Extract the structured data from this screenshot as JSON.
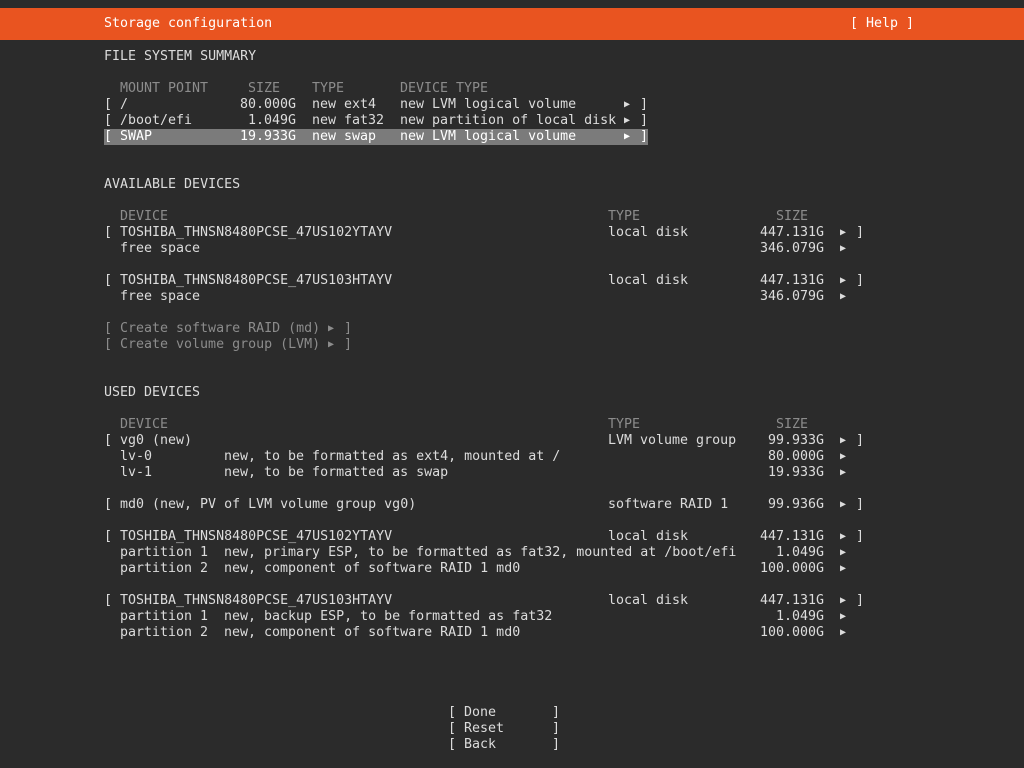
{
  "header": {
    "title": "Storage configuration",
    "help": "[ Help ]"
  },
  "fs_summary": {
    "heading": "FILE SYSTEM SUMMARY",
    "columns": [
      "MOUNT POINT",
      "SIZE",
      "TYPE",
      "DEVICE TYPE"
    ],
    "rows": [
      {
        "mount": "/",
        "size": "80.000G",
        "type": "new ext4",
        "device_type": "new LVM logical volume"
      },
      {
        "mount": "/boot/efi",
        "size": "1.049G",
        "type": "new fat32",
        "device_type": "new partition of local disk"
      },
      {
        "mount": "SWAP",
        "size": "19.933G",
        "type": "new swap",
        "device_type": "new LVM logical volume"
      }
    ]
  },
  "available": {
    "heading": "AVAILABLE DEVICES",
    "columns": [
      "DEVICE",
      "TYPE",
      "SIZE"
    ],
    "disks": [
      {
        "name": "TOSHIBA_THNSN8480PCSE_47US102YTAYV",
        "type": "local disk",
        "size": "447.131G",
        "free_label": "free space",
        "free_size": "346.079G"
      },
      {
        "name": "TOSHIBA_THNSN8480PCSE_47US103HTAYV",
        "type": "local disk",
        "size": "447.131G",
        "free_label": "free space",
        "free_size": "346.079G"
      }
    ],
    "actions": [
      "Create software RAID (md)",
      "Create volume group (LVM)"
    ]
  },
  "used": {
    "heading": "USED DEVICES",
    "columns": [
      "DEVICE",
      "TYPE",
      "SIZE"
    ],
    "vg": {
      "name": "vg0 (new)",
      "type": "LVM volume group",
      "size": "99.933G"
    },
    "lvs": [
      {
        "name": "lv-0",
        "desc": "new, to be formatted as ext4, mounted at /",
        "size": "80.000G"
      },
      {
        "name": "lv-1",
        "desc": "new, to be formatted as swap",
        "size": "19.933G"
      }
    ],
    "md": {
      "name": "md0 (new, PV of LVM volume group vg0)",
      "type": "software RAID 1",
      "size": "99.936G"
    },
    "disks": [
      {
        "name": "TOSHIBA_THNSN8480PCSE_47US102YTAYV",
        "type": "local disk",
        "size": "447.131G",
        "partitions": [
          {
            "name": "partition 1",
            "desc": "new, primary ESP, to be formatted as fat32, mounted at /boot/efi",
            "size": "1.049G"
          },
          {
            "name": "partition 2",
            "desc": "new, component of software RAID 1 md0",
            "size": "100.000G"
          }
        ]
      },
      {
        "name": "TOSHIBA_THNSN8480PCSE_47US103HTAYV",
        "type": "local disk",
        "size": "447.131G",
        "partitions": [
          {
            "name": "partition 1",
            "desc": "new, backup ESP, to be formatted as fat32",
            "size": "1.049G"
          },
          {
            "name": "partition 2",
            "desc": "new, component of software RAID 1 md0",
            "size": "100.000G"
          }
        ]
      }
    ]
  },
  "buttons": {
    "done": "Done",
    "reset": "Reset",
    "back": "Back"
  },
  "glyphs": {
    "open": "[",
    "close": "]",
    "arrow": "▶"
  },
  "colors": {
    "accent": "#e95420",
    "background": "#2b2b2b",
    "selected": "#7b7b7b"
  }
}
